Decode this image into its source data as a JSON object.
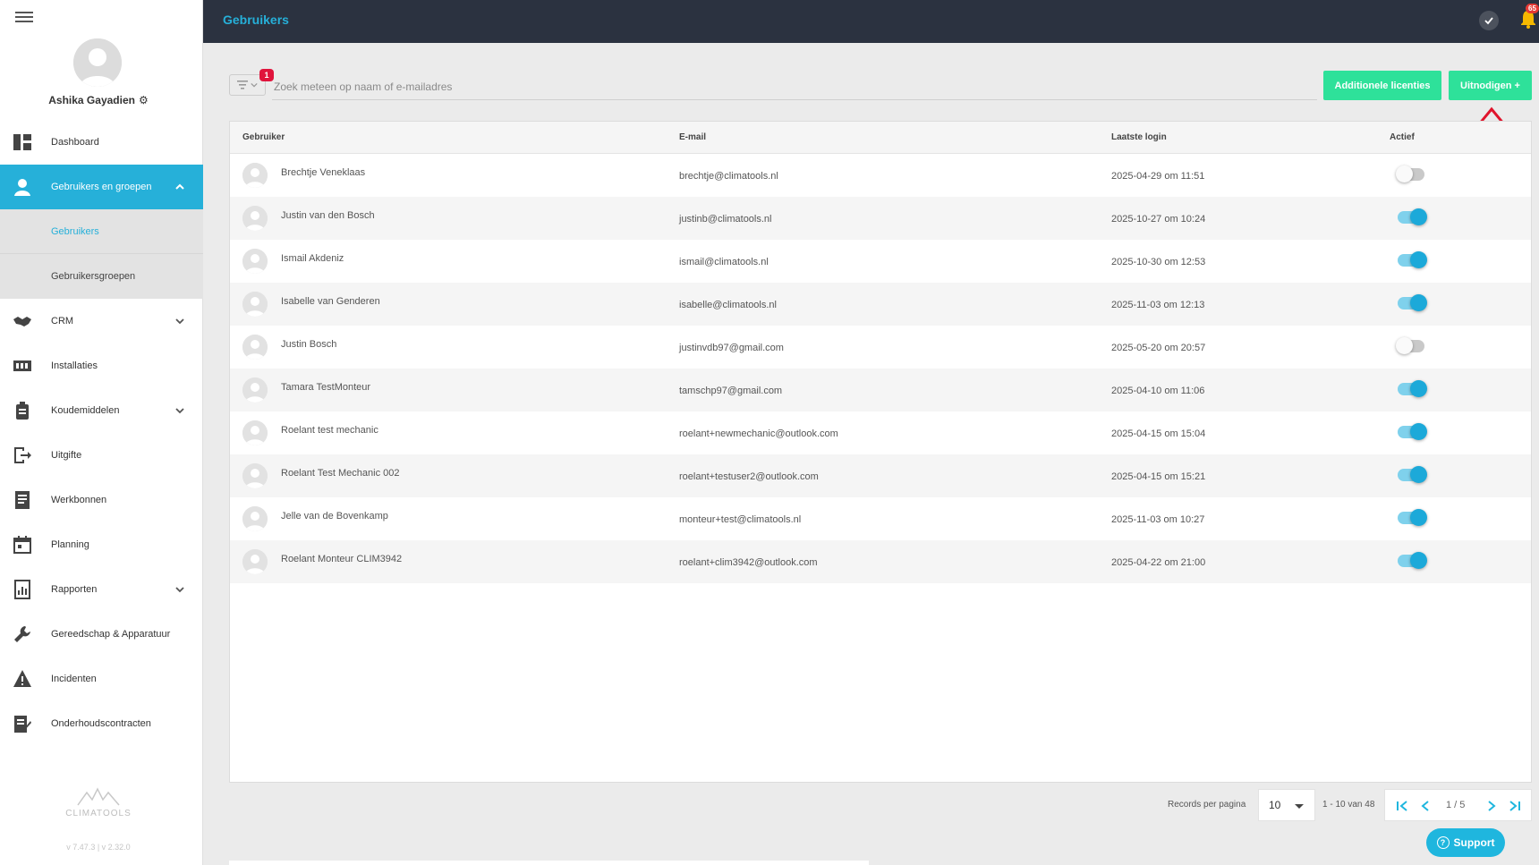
{
  "app": {
    "page_title": "Gebruikers"
  },
  "user": {
    "name": "Ashika Gayadien"
  },
  "sidebar": {
    "items": [
      {
        "label": "Dashboard",
        "icon": "dashboard-icon"
      },
      {
        "label": "Gebruikers en groepen",
        "icon": "user-icon"
      },
      {
        "label": "CRM",
        "icon": "handshake-icon"
      },
      {
        "label": "Installaties",
        "icon": "installation-icon"
      },
      {
        "label": "Koudemiddelen",
        "icon": "refrigerant-icon"
      },
      {
        "label": "Uitgifte",
        "icon": "exit-icon"
      },
      {
        "label": "Werkbonnen",
        "icon": "document-icon"
      },
      {
        "label": "Planning",
        "icon": "calendar-icon"
      },
      {
        "label": "Rapporten",
        "icon": "report-icon"
      },
      {
        "label": "Gereedschap & Apparatuur",
        "icon": "wrench-icon"
      },
      {
        "label": "Incidenten",
        "icon": "warning-icon"
      },
      {
        "label": "Onderhoudscontracten",
        "icon": "contract-icon"
      }
    ],
    "sub_items": [
      {
        "label": "Gebruikers"
      },
      {
        "label": "Gebruikersgroepen"
      }
    ],
    "brand": "CLIMATOOLS",
    "version": "v 7.47.3 | v 2.32.0"
  },
  "topbar": {
    "notification_count": "65"
  },
  "toolbar": {
    "filter_count": "1",
    "search_placeholder": "Zoek meteen op naam of e-mailadres",
    "licenses_label": "Additionele licenties",
    "invite_label": "Uitnodigen +"
  },
  "table": {
    "headers": [
      "Gebruiker",
      "E-mail",
      "Laatste login",
      "Actief"
    ],
    "rows": [
      {
        "name": "Brechtje Veneklaas",
        "email": "brechtje@climatools.nl",
        "last_login": "2025-04-29 om 11:51",
        "active": false
      },
      {
        "name": "Justin van den Bosch",
        "email": "justinb@climatools.nl",
        "last_login": "2025-10-27 om 10:24",
        "active": true
      },
      {
        "name": "Ismail Akdeniz",
        "email": "ismail@climatools.nl",
        "last_login": "2025-10-30 om 12:53",
        "active": true
      },
      {
        "name": "Isabelle van Genderen",
        "email": "isabelle@climatools.nl",
        "last_login": "2025-11-03 om 12:13",
        "active": true
      },
      {
        "name": "Justin Bosch",
        "email": "justinvdb97@gmail.com",
        "last_login": "2025-05-20 om 20:57",
        "active": false
      },
      {
        "name": "Tamara TestMonteur",
        "email": "tamschp97@gmail.com",
        "last_login": "2025-04-10 om 11:06",
        "active": true
      },
      {
        "name": "Roelant test mechanic",
        "email": "roelant+newmechanic@outlook.com",
        "last_login": "2025-04-15 om 15:04",
        "active": true
      },
      {
        "name": "Roelant Test Mechanic 002",
        "email": "roelant+testuser2@outlook.com",
        "last_login": "2025-04-15 om 15:21",
        "active": true
      },
      {
        "name": "Jelle van de Bovenkamp",
        "email": "monteur+test@climatools.nl",
        "last_login": "2025-11-03 om 10:27",
        "active": true
      },
      {
        "name": "Roelant Monteur CLIM3942",
        "email": "roelant+clim3942@outlook.com",
        "last_login": "2025-04-22 om 21:00",
        "active": true
      }
    ]
  },
  "pagination": {
    "records_label": "Records per pagina",
    "per_page": "10",
    "range": "1 - 10 van 48",
    "page": "1 / 5"
  },
  "support": {
    "label": "Support"
  },
  "colors": {
    "accent": "#26b0d9",
    "green": "#2ee19a",
    "topbar": "#2b3240",
    "badge": "#e0143c"
  }
}
